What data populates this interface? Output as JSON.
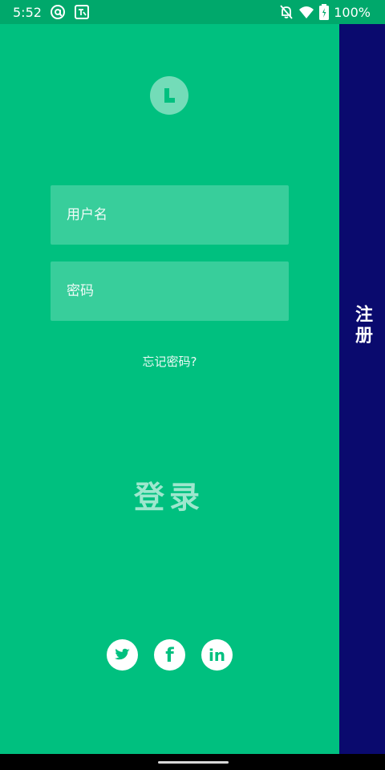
{
  "status_bar": {
    "time": "5:52",
    "battery": "100%",
    "left_icons": [
      "at-sign-icon",
      "translate-icon"
    ],
    "right_icons": [
      "notifications-off-icon",
      "wifi-icon",
      "battery-icon"
    ]
  },
  "login": {
    "logo_icon": "logo-l-icon",
    "username_placeholder": "用户名",
    "password_placeholder": "密码",
    "forgot_password": "忘记密码?",
    "submit_label": "登录",
    "social_icons": [
      "twitter-icon",
      "facebook-icon",
      "linkedin-icon"
    ],
    "facebook_glyph": "f",
    "linkedin_glyph": "in"
  },
  "register": {
    "label": "注册"
  },
  "colors": {
    "primary_green": "#00c07f",
    "status_green": "#00a86b",
    "register_navy": "#0a0a6e"
  }
}
